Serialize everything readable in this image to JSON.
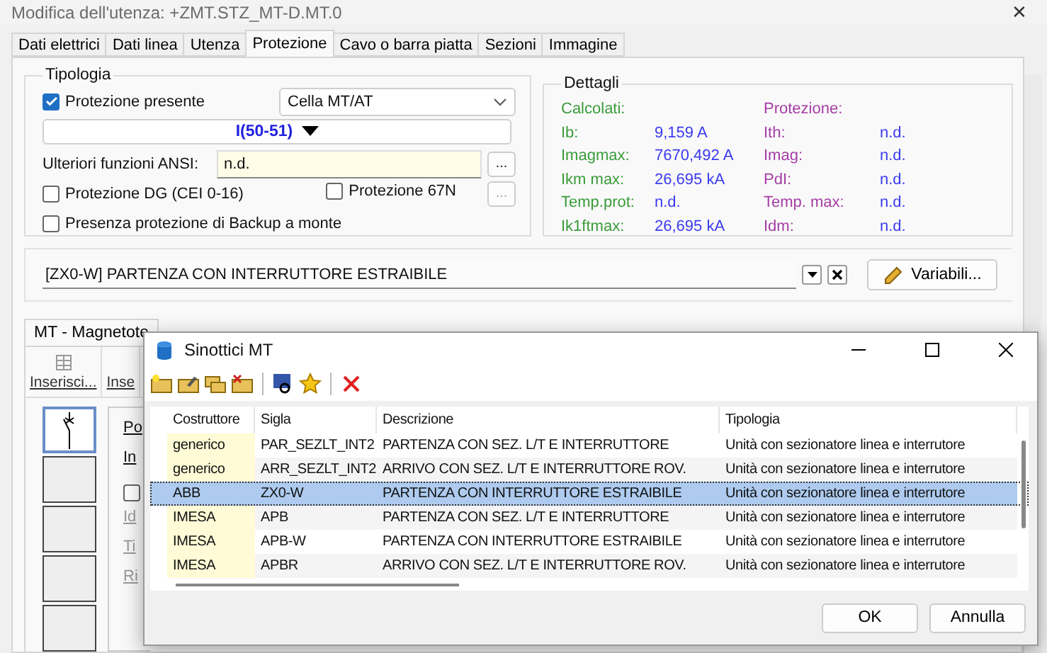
{
  "window": {
    "title": "Modifica dell'utenza: +ZMT.STZ_MT-D.MT.0",
    "close": "✕"
  },
  "tabs": [
    {
      "label": "Dati elettrici",
      "selected": false
    },
    {
      "label": "Dati linea",
      "selected": false
    },
    {
      "label": "Utenza",
      "selected": false
    },
    {
      "label": "Protezione",
      "selected": true
    },
    {
      "label": "Cavo o barra piatta",
      "selected": false
    },
    {
      "label": "Sezioni",
      "selected": false
    },
    {
      "label": "Immagine",
      "selected": false
    }
  ],
  "tipologia": {
    "title": "Tipologia",
    "protezione_presente": {
      "label": "Protezione presente",
      "checked": true
    },
    "cella": {
      "value": "Cella MT/AT"
    },
    "funzione": {
      "label": "I(50-51)"
    },
    "ansi": {
      "label": "Ulteriori funzioni ANSI:",
      "value": "n.d.",
      "button": "..."
    },
    "dg": {
      "label": "Protezione DG (CEI 0-16)",
      "checked": false
    },
    "p67n": {
      "label": "Protezione 67N",
      "checked": false,
      "button": "...",
      "disabled": true
    },
    "backup": {
      "label": "Presenza protezione di Backup a monte",
      "checked": false
    }
  },
  "dettagli": {
    "title": "Dettagli",
    "calcolati": {
      "heading": "Calcolati:",
      "rows": [
        {
          "label": "Ib:",
          "value": "9,159 A"
        },
        {
          "label": "Imagmax:",
          "value": "7670,492 A"
        },
        {
          "label": "Ikm max:",
          "value": "26,695 kA"
        },
        {
          "label": "Temp.prot:",
          "value": "n.d."
        },
        {
          "label": "Ik1ftmax:",
          "value": "26,695 kA"
        }
      ]
    },
    "protezione": {
      "heading": "Protezione:",
      "rows": [
        {
          "label": "Ith:",
          "value": "n.d."
        },
        {
          "label": "Imag:",
          "value": "n.d."
        },
        {
          "label": "PdI:",
          "value": "n.d."
        },
        {
          "label": "Temp. max:",
          "value": "n.d."
        },
        {
          "label": "Idm:",
          "value": "n.d."
        }
      ]
    }
  },
  "schema": {
    "value": "[ZX0-W] PARTENZA CON INTERRUTTORE ESTRAIBILE",
    "button": "Variabili..."
  },
  "lower": {
    "tab": "MT - Magnetote",
    "tools": [
      "Inserisci...",
      "Inse"
    ],
    "symbols": [
      {
        "selected": true
      },
      {
        "selected": false
      },
      {
        "selected": false
      },
      {
        "selected": false
      },
      {
        "selected": false
      }
    ],
    "fields": [
      {
        "kind": "label",
        "text": "Po",
        "disabled": false
      },
      {
        "kind": "label",
        "text": "In",
        "disabled": false
      },
      {
        "kind": "checkbox",
        "checked": false
      },
      {
        "kind": "label",
        "text": "Id",
        "disabled": true
      },
      {
        "kind": "label",
        "text": "Ti",
        "disabled": true
      },
      {
        "kind": "label",
        "text": "Ri",
        "disabled": true
      }
    ]
  },
  "dialog": {
    "title": "Sinottici MT",
    "columns": [
      "Costruttore",
      "Sigla",
      "Descrizione",
      "Tipologia"
    ],
    "rows": [
      {
        "cells": [
          "generico",
          "PAR_SEZLT_INT2",
          "PARTENZA CON SEZ. L/T E INTERRUTTORE",
          "Unità con sezionatore linea e interrutore"
        ],
        "selected": false
      },
      {
        "cells": [
          "generico",
          "ARR_SEZLT_INT2",
          "ARRIVO CON SEZ. L/T E INTERRUTTORE ROV.",
          "Unità con sezionatore linea e interrutore"
        ],
        "selected": false
      },
      {
        "cells": [
          "ABB",
          "ZX0-W",
          "PARTENZA CON INTERRUTTORE ESTRAIBILE",
          "Unità con sezionatore linea e interrutore"
        ],
        "selected": true
      },
      {
        "cells": [
          "IMESA",
          "APB",
          "PARTENZA CON SEZ. L/T E INTERRUTTORE",
          "Unità con sezionatore linea e interrutore"
        ],
        "selected": false
      },
      {
        "cells": [
          "IMESA",
          "APB-W",
          "PARTENZA CON INTERRUTTORE ESTRAIBILE",
          "Unità con sezionatore linea e interrutore"
        ],
        "selected": false
      },
      {
        "cells": [
          "IMESA",
          "APBR",
          "ARRIVO CON SEZ. L/T E INTERRUTTORE ROV.",
          "Unità con sezionatore linea e interrutore"
        ],
        "selected": false
      }
    ],
    "buttons": [
      "OK",
      "Annulla"
    ]
  }
}
